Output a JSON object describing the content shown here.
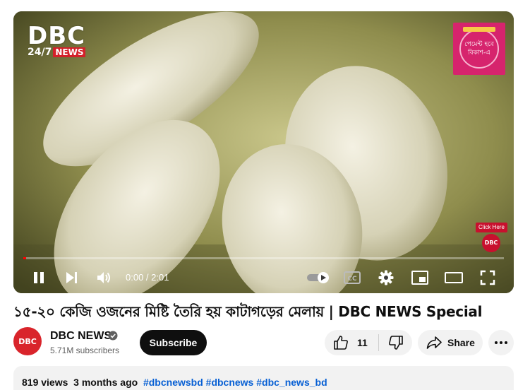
{
  "player": {
    "logo_main": "DBC",
    "logo_247": "24/7",
    "logo_news": "NEWS",
    "ad_line1": "পেমেন্ট হবে",
    "ad_line2": "বিকাশ-এ",
    "click_here": "Click Here",
    "click_logo": "DBC",
    "time_display": "0:00 / 2:01",
    "progress_fraction": 0.0,
    "controls": [
      "play-pause",
      "next",
      "volume",
      "autoplay",
      "captions",
      "settings",
      "miniplayer",
      "theater",
      "fullscreen"
    ]
  },
  "video": {
    "title": "১৫-২০ কেজি ওজনের মিষ্টি তৈরি হয় কাটাগড়ের মেলায় | DBC NEWS Special"
  },
  "channel": {
    "avatar_text": "DBC",
    "name": "DBC NEWS",
    "subscribers": "5.71M subscribers",
    "subscribe_label": "Subscribe"
  },
  "actions": {
    "like_count": "11",
    "share_label": "Share"
  },
  "description": {
    "views": "819 views",
    "age": "3 months ago",
    "hashtags": [
      "#dbcnewsbd",
      "#dbcnews",
      "#dbc_news_bd"
    ]
  },
  "colors": {
    "accent_red": "#ff0000",
    "brand_red": "#d9242b",
    "link_blue": "#065fd4",
    "pill_bg": "#f2f2f2"
  }
}
